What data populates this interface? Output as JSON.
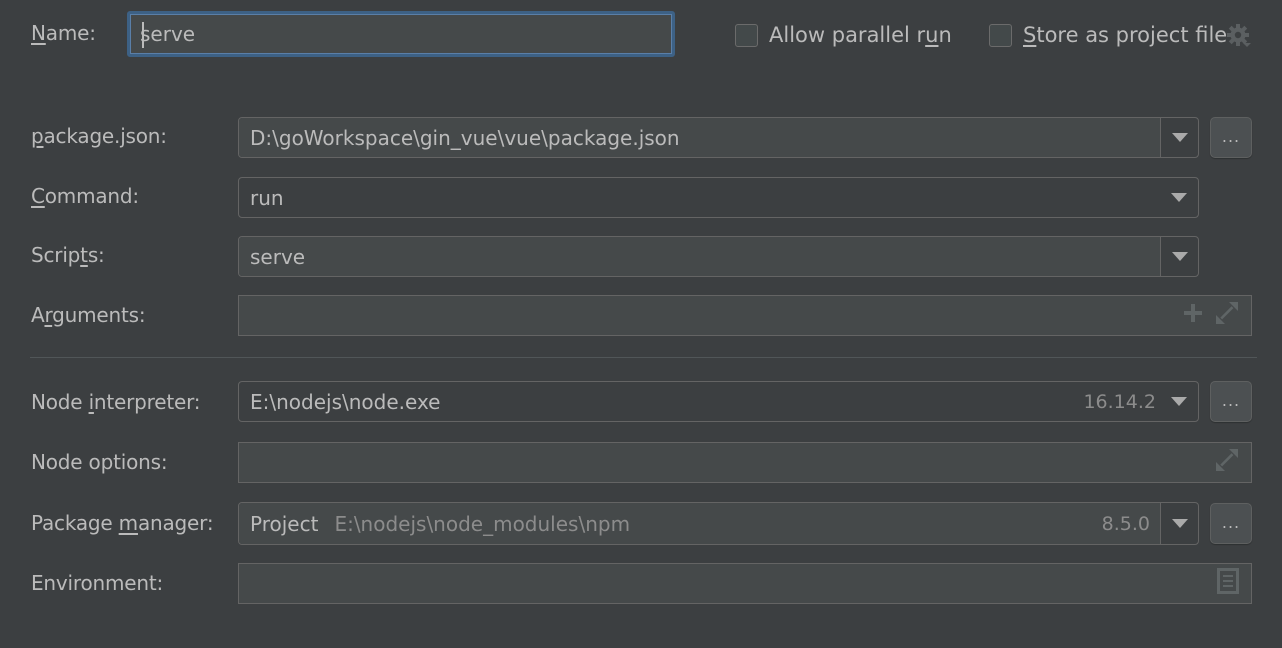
{
  "name": {
    "label": "Name:",
    "label_mnemonic": "N",
    "label_rest": "ame:",
    "value": "serve"
  },
  "options": {
    "allow_parallel_run": {
      "label_before": "Allow parallel r",
      "label_mnemonic": "u",
      "label_after": "n",
      "checked": false
    },
    "store_as_project_file": {
      "label_before": "",
      "label_mnemonic": "S",
      "label_after": "tore as project file",
      "checked": false
    },
    "settings_icon": "gear-icon"
  },
  "fields": {
    "package_json": {
      "label_before": "",
      "label_mnemonic": "p",
      "label_after": "ackage.json:",
      "value": "D:\\goWorkspace\\gin_vue\\vue\\package.json",
      "browse_label": "..."
    },
    "command": {
      "label_before": "",
      "label_mnemonic": "C",
      "label_after": "ommand:",
      "value": "run"
    },
    "scripts": {
      "label_before": "Scrip",
      "label_mnemonic": "t",
      "label_after": "s:",
      "value": "serve"
    },
    "arguments": {
      "label_before": "A",
      "label_mnemonic": "r",
      "label_after": "guments:",
      "value": ""
    },
    "node_interpreter": {
      "label_before": "Node ",
      "label_mnemonic": "i",
      "label_after": "nterpreter:",
      "value": "E:\\nodejs\\node.exe",
      "version": "16.14.2",
      "browse_label": "..."
    },
    "node_options": {
      "label": "Node options:",
      "value": ""
    },
    "package_manager": {
      "label_before": "Package ",
      "label_mnemonic": "m",
      "label_after": "anager:",
      "value": "Project",
      "path": "E:\\nodejs\\node_modules\\npm",
      "version": "8.5.0",
      "browse_label": "..."
    },
    "environment": {
      "label": "Environment:",
      "value": ""
    }
  },
  "colors": {
    "background": "#3c3f41",
    "field_background": "#45494a",
    "border": "#646464",
    "focus_border": "#3d6185",
    "text": "#bbbbbb",
    "hint_text": "#8c8c8c"
  }
}
